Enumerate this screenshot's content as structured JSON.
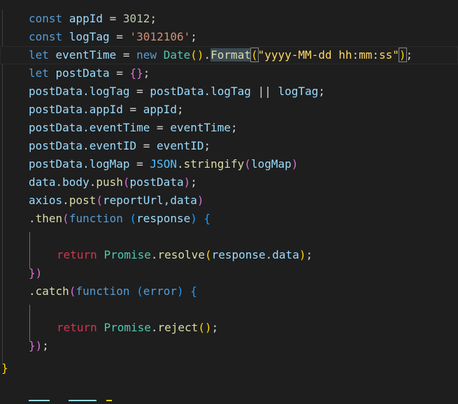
{
  "code": {
    "l01": {
      "a": "const",
      "b": "appId",
      "c": "=",
      "d": "3012",
      "e": ";"
    },
    "l02": {
      "a": "const",
      "b": "logTag",
      "c": "=",
      "d": "'3012106'",
      "e": ";"
    },
    "l03": {
      "a": "let",
      "b": "eventTime",
      "c": "=",
      "d": "new",
      "e": "Date",
      "f": "()",
      "g": ".",
      "h": "Format",
      "i": "(",
      "j": "\"yyyy-MM-dd hh:mm:ss\"",
      "k": ")",
      "l": ";"
    },
    "l04": {
      "a": "let",
      "b": "postData",
      "c": "=",
      "d": "{}",
      "e": ";"
    },
    "l05": {
      "a": "postData",
      "b": ".logTag",
      "c": "=",
      "d": "postData",
      "e": ".logTag",
      "f": "||",
      "g": "logTag",
      "h": ";"
    },
    "l06": {
      "a": "postData",
      "b": ".appId",
      "c": "=",
      "d": "appId",
      "e": ";"
    },
    "l07": {
      "a": "postData",
      "b": ".eventTime",
      "c": "=",
      "d": "eventTime",
      "e": ";"
    },
    "l08": {
      "a": "postData",
      "b": ".eventID",
      "c": "=",
      "d": "eventID",
      "e": ";"
    },
    "l09": {
      "a": "postData",
      "b": ".logMap",
      "c": "=",
      "d": "JSON",
      "e": ".",
      "f": "stringify",
      "g": "(",
      "h": "logMap",
      "i": ")"
    },
    "l10": {
      "a": "data",
      "b": ".body",
      "c": ".",
      "d": "push",
      "e": "(",
      "f": "postData",
      "g": ")",
      "h": ";"
    },
    "l11": {
      "a": "axios",
      "b": ".",
      "c": "post",
      "d": "(",
      "e": "reportUrl,data",
      "f": ")"
    },
    "l12": {
      "a": ".",
      "b": "then",
      "c": "(",
      "d": "function",
      "e": "(",
      "f": "response",
      "g": ")",
      "h": "{"
    },
    "l14": {
      "a": "return",
      "b": "Promise",
      "c": ".",
      "d": "resolve",
      "e": "(",
      "f": "response",
      "g": ".data",
      "h": ")",
      "i": ";"
    },
    "l15": {
      "a": "})"
    },
    "l16": {
      "a": ".",
      "b": "catch",
      "c": "(",
      "d": "function",
      "e": "(",
      "f": "error",
      "g": ")",
      "h": "{"
    },
    "l18": {
      "a": "return",
      "b": "Promise",
      "c": ".",
      "d": "reject",
      "e": "()",
      "f": ";"
    },
    "l19": {
      "a": "})",
      "b": ";"
    },
    "l20": {
      "a": "}"
    }
  }
}
